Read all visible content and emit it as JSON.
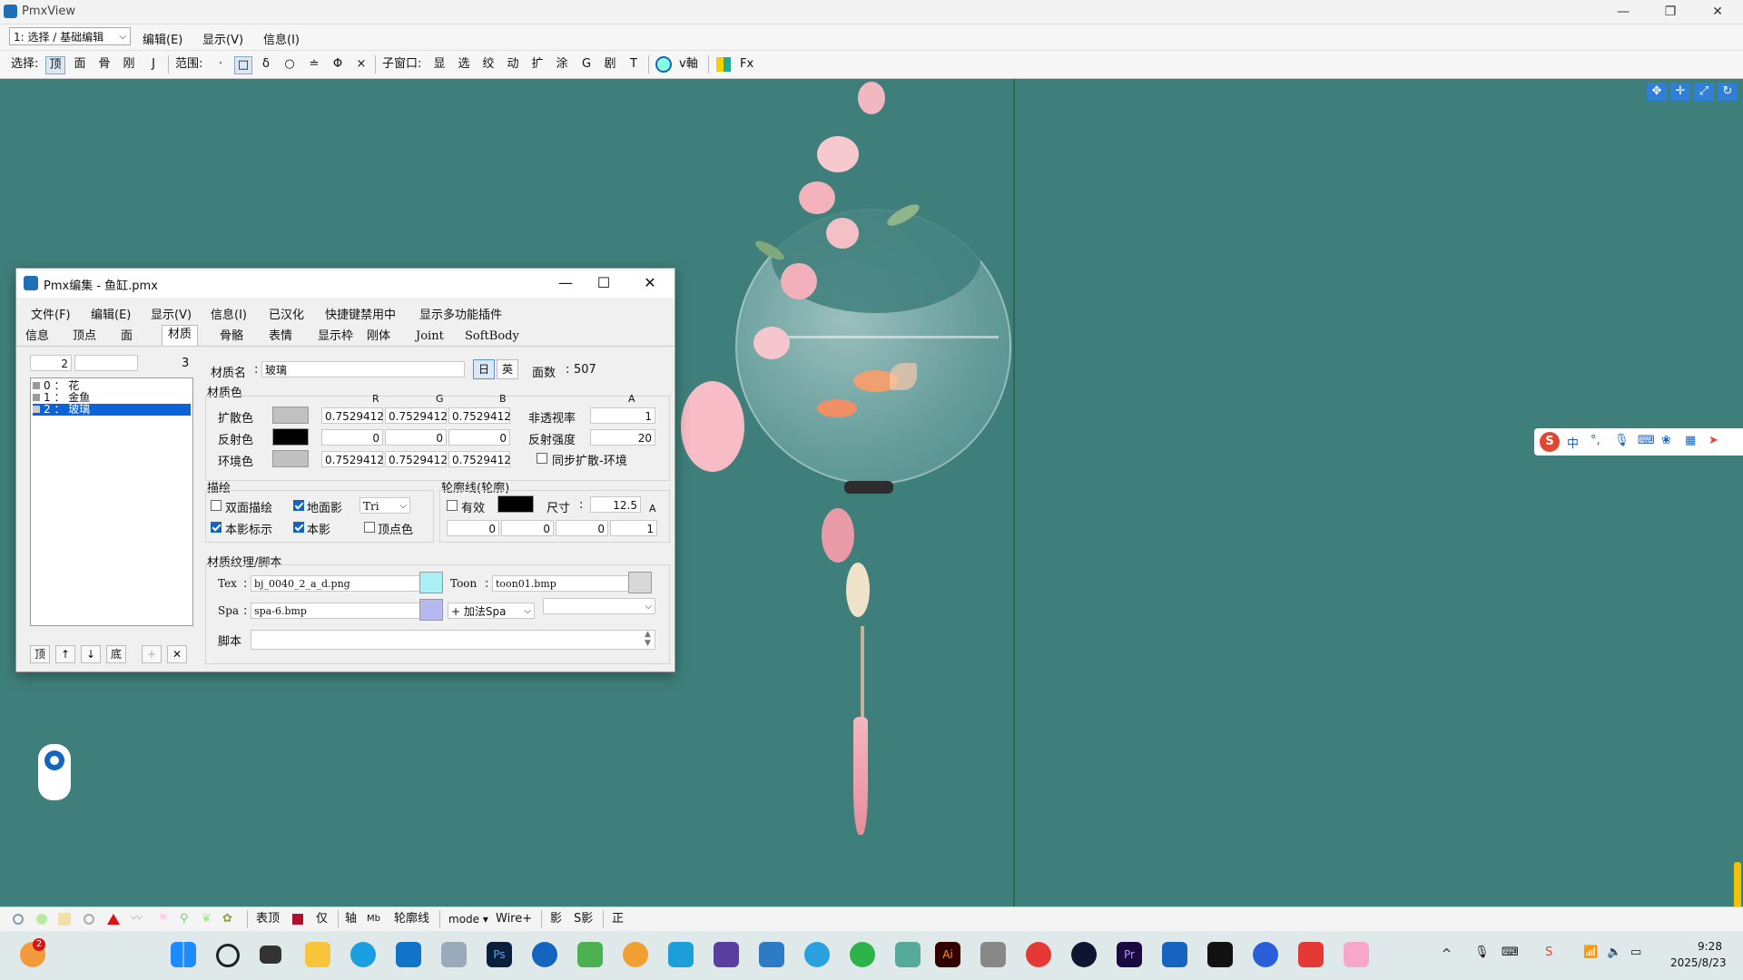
{
  "window": {
    "title": "PmxView",
    "min": "—",
    "max": "❐",
    "close": "✕"
  },
  "menubar": {
    "mode_select": "1: 选择 / 基础编辑",
    "items": [
      "编辑(E)",
      "显示(V)",
      "信息(I)"
    ]
  },
  "toolbar": {
    "select_label": "选择:",
    "select_btns": [
      "顶",
      "面",
      "骨",
      "刚",
      "J"
    ],
    "range_label": "范围:",
    "range_btns": [
      "·",
      "□",
      "δ",
      "○",
      "≐",
      "Φ",
      "×"
    ],
    "sub_label": "子窗口:",
    "sub_btns": [
      "显",
      "选",
      "绞",
      "动",
      "扩",
      "涂",
      "G",
      "剧",
      "T"
    ],
    "extra": [
      "v軸",
      "Fx"
    ]
  },
  "bottombar": {
    "items": [
      "表顶",
      "仅",
      "轴",
      "轮廓线",
      "mode ▾",
      "Wire+",
      "影",
      "S影",
      "正"
    ]
  },
  "dialog": {
    "title": "Pmx编集 - 鱼缸.pmx",
    "menu": [
      "文件(F)",
      "编辑(E)",
      "显示(V)",
      "信息(I)",
      "已汉化",
      "快捷键禁用中",
      "显示多功能插件"
    ],
    "tabs": [
      "信息",
      "顶点",
      "面",
      "材质",
      "骨骼",
      "表情",
      "显示枠",
      "刚体",
      "Joint",
      "SoftBody"
    ],
    "active_tab": "材质",
    "list_index": "2",
    "list_count": "3",
    "materials": [
      {
        "idx": "0",
        "name": "花"
      },
      {
        "idx": "1",
        "name": "金鱼"
      },
      {
        "idx": "2",
        "name": "玻璃"
      }
    ],
    "selected_material": 2,
    "list_buttons": [
      "顶",
      "↑",
      "↓",
      "底",
      "+",
      "✕"
    ],
    "material_name_label": "材质名",
    "material_name": "玻璃",
    "lang_btns": [
      "日",
      "英"
    ],
    "face_count_label": "面数",
    "face_count": "507",
    "color_section": "材质色",
    "rgb_headers": [
      "R",
      "G",
      "B",
      "A"
    ],
    "diffuse_label": "扩散色",
    "diffuse": {
      "r": "0.7529412",
      "g": "0.7529412",
      "b": "0.7529412",
      "swatch": "#c0c0c0"
    },
    "specular_label": "反射色",
    "specular": {
      "r": "0",
      "g": "0",
      "b": "0",
      "swatch": "#000000"
    },
    "ambient_label": "环境色",
    "ambient": {
      "r": "0.7529412",
      "g": "0.7529412",
      "b": "0.7529412",
      "swatch": "#c0c0c0"
    },
    "opacity_label": "非透视率",
    "opacity": "1",
    "spec_power_label": "反射强度",
    "spec_power": "20",
    "sync_label": "同步扩散-环境",
    "draw_section": "描绘",
    "double_sided": "双面描绘",
    "ground_shadow": "地面影",
    "tri_select": "Tri",
    "self_shadow_map": "本影标示",
    "self_shadow": "本影",
    "vertex_color": "顶点色",
    "edge_section": "轮廓线(轮廓)",
    "edge_valid": "有效",
    "edge_color": "#000000",
    "edge_size_label": "尺寸",
    "edge_size": "12.5",
    "edge_rgba": [
      "0",
      "0",
      "0",
      "1"
    ],
    "tex_section": "材质纹理/脚本",
    "tex_label": "Tex",
    "tex_value": "bj_0040_2_a_d.png",
    "tex_swatch": "#a8f0f4",
    "toon_label": "Toon",
    "toon_value": "toon01.bmp",
    "toon_swatch": "#d8d8d8",
    "spa_label": "Spa",
    "spa_value": "spa-6.bmp",
    "spa_swatch": "#b8b8f0",
    "spa_mode": "+ 加法Spa",
    "script_label": "脚本"
  },
  "ime": {
    "items": [
      "中",
      "°,"
    ]
  },
  "clock": {
    "time": "9:28",
    "date": "2025/8/23"
  },
  "notification_badge": "2"
}
